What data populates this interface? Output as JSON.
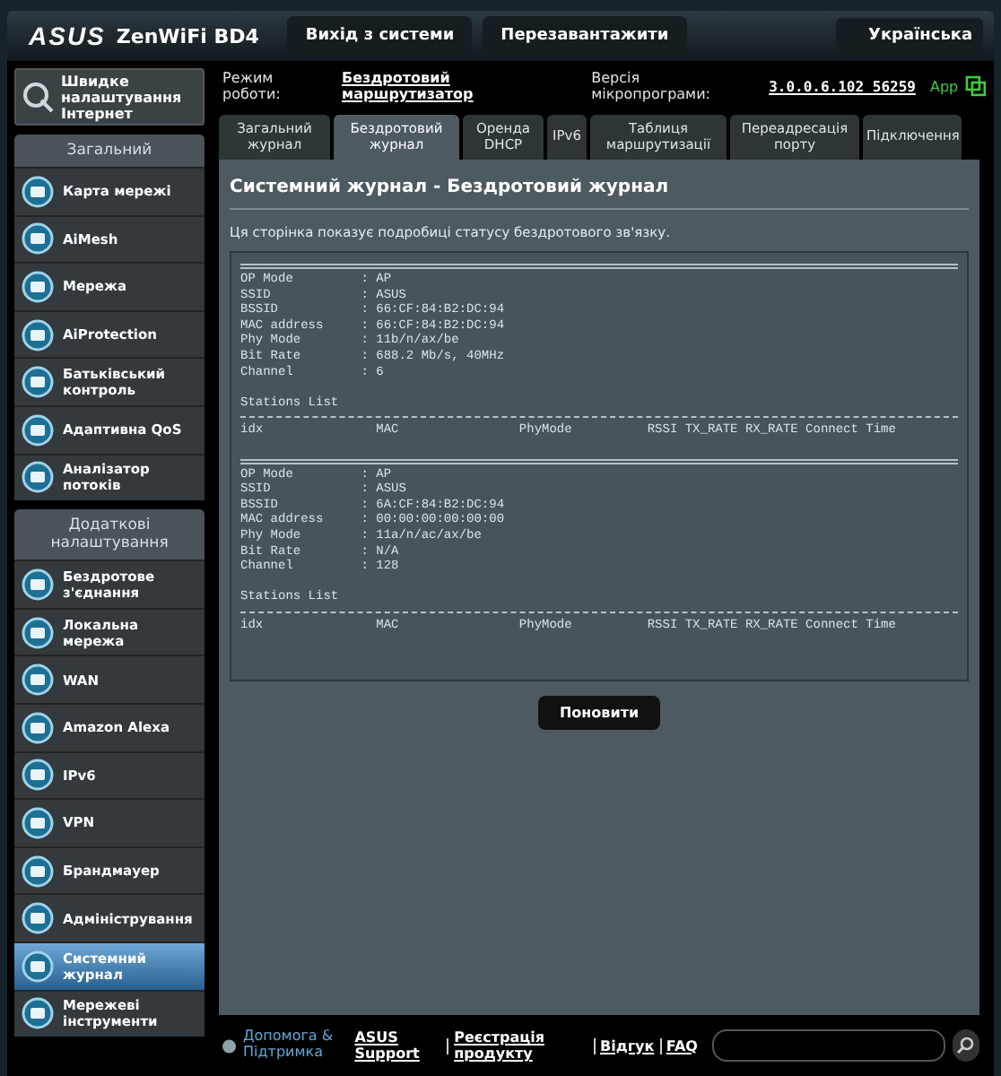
{
  "header": {
    "logo": "ASUS",
    "model": "ZenWiFi BD4",
    "buttons": [
      "Вихід з системи",
      "Перезавантажити"
    ],
    "language": "Українська"
  },
  "status": {
    "mode_label": "Режим роботи:",
    "mode": "Бездротовий маршрутизатор",
    "firmware_label": "Версія мікропрограми:",
    "firmware": "3.0.0.6.102_56259",
    "app": "App"
  },
  "sidebar": {
    "quick_setup": "Швидке налаштування Інтернет",
    "sections": [
      {
        "title": "Загальний",
        "items": [
          {
            "label": "Карта мережі",
            "selected": false
          },
          {
            "label": "AiMesh",
            "selected": false
          },
          {
            "label": "Мережа",
            "selected": false
          },
          {
            "label": "AiProtection",
            "selected": false
          },
          {
            "label": "Батьківський контроль",
            "selected": false
          },
          {
            "label": "Адаптивна QoS",
            "selected": false
          },
          {
            "label": "Аналізатор потоків",
            "selected": false
          }
        ]
      },
      {
        "title": "Додаткові налаштування",
        "items": [
          {
            "label": "Бездротове з'єднання",
            "selected": false
          },
          {
            "label": "Локальна мережа",
            "selected": false
          },
          {
            "label": "WAN",
            "selected": false
          },
          {
            "label": "Amazon Alexa",
            "selected": false
          },
          {
            "label": "IPv6",
            "selected": false
          },
          {
            "label": "VPN",
            "selected": false
          },
          {
            "label": "Брандмауер",
            "selected": false
          },
          {
            "label": "Адміністрування",
            "selected": false
          },
          {
            "label": "Системний журнал",
            "selected": true
          },
          {
            "label": "Мережеві інструменти",
            "selected": false
          }
        ]
      }
    ]
  },
  "tabs": [
    {
      "label": "Загальний журнал",
      "selected": false
    },
    {
      "label": "Бездротовий журнал",
      "selected": true
    },
    {
      "label": "Оренда DHCP",
      "selected": false
    },
    {
      "label": "IPv6",
      "selected": false
    },
    {
      "label": "Таблиця маршрутизації",
      "selected": false
    },
    {
      "label": "Переадресація порту",
      "selected": false
    },
    {
      "label": "Підключення",
      "selected": false
    }
  ],
  "panel": {
    "title": "Системний журнал - Бездротовий журнал",
    "description": "Ця сторінка показує подробиці статусу бездротового зв'язку.",
    "log": [
      {
        "kind": "rule_double"
      },
      {
        "kind": "line",
        "text": "OP Mode         : AP"
      },
      {
        "kind": "line",
        "text": "SSID            : ASUS"
      },
      {
        "kind": "line",
        "text": "BSSID           : 66:CF:84:B2:DC:94"
      },
      {
        "kind": "line",
        "text": "MAC address     : 66:CF:84:B2:DC:94"
      },
      {
        "kind": "line",
        "text": "Phy Mode        : 11b/n/ax/be"
      },
      {
        "kind": "line",
        "text": "Bit Rate        : 688.2 Mb/s, 40MHz"
      },
      {
        "kind": "line",
        "text": "Channel         : 6"
      },
      {
        "kind": "blank"
      },
      {
        "kind": "line",
        "text": "Stations List"
      },
      {
        "kind": "rule_single"
      },
      {
        "kind": "line",
        "text": "idx               MAC                PhyMode          RSSI TX_RATE RX_RATE Connect Time"
      },
      {
        "kind": "blank"
      },
      {
        "kind": "rule_double"
      },
      {
        "kind": "line",
        "text": "OP Mode         : AP"
      },
      {
        "kind": "line",
        "text": "SSID            : ASUS"
      },
      {
        "kind": "line",
        "text": "BSSID           : 6A:CF:84:B2:DC:94"
      },
      {
        "kind": "line",
        "text": "MAC address     : 00:00:00:00:00:00"
      },
      {
        "kind": "line",
        "text": "Phy Mode        : 11a/n/ac/ax/be"
      },
      {
        "kind": "line",
        "text": "Bit Rate        : N/A"
      },
      {
        "kind": "line",
        "text": "Channel         : 128"
      },
      {
        "kind": "blank"
      },
      {
        "kind": "line",
        "text": "Stations List"
      },
      {
        "kind": "rule_single"
      },
      {
        "kind": "line",
        "text": "idx               MAC                PhyMode          RSSI TX_RATE RX_RATE Connect Time"
      }
    ],
    "button": "Поновити"
  },
  "footer": {
    "help": "Допомога & Підтримка",
    "links": [
      "ASUS Support",
      "Реєстрація продукту",
      "Відгук",
      "FAQ"
    ]
  }
}
